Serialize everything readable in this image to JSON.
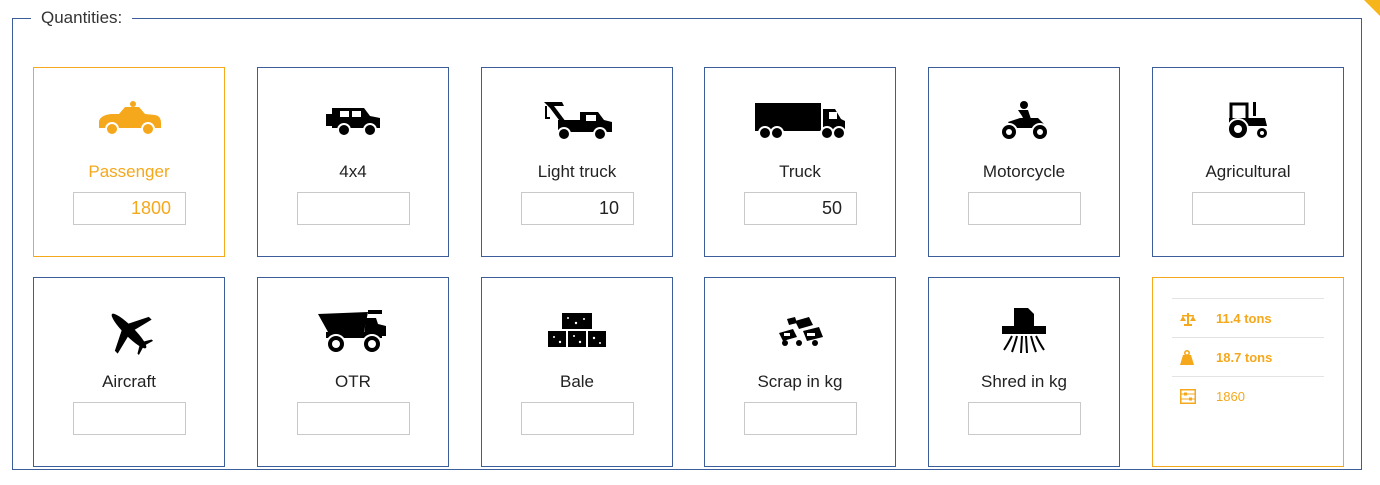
{
  "legend": "Quantities:",
  "cards": [
    {
      "id": "passenger",
      "label": "Passenger",
      "value": "1800",
      "icon": "passenger-car-icon",
      "selected": true
    },
    {
      "id": "4x4",
      "label": "4x4",
      "value": "",
      "icon": "jeep-icon",
      "selected": false
    },
    {
      "id": "light-truck",
      "label": "Light truck",
      "value": "10",
      "icon": "tow-truck-icon",
      "selected": false
    },
    {
      "id": "truck",
      "label": "Truck",
      "value": "50",
      "icon": "semi-truck-icon",
      "selected": false
    },
    {
      "id": "motorcycle",
      "label": "Motorcycle",
      "value": "",
      "icon": "motorcycle-icon",
      "selected": false
    },
    {
      "id": "agricultural",
      "label": "Agricultural",
      "value": "",
      "icon": "tractor-icon",
      "selected": false
    },
    {
      "id": "aircraft",
      "label": "Aircraft",
      "value": "",
      "icon": "airplane-icon",
      "selected": false
    },
    {
      "id": "otr",
      "label": "OTR",
      "value": "",
      "icon": "dump-truck-icon",
      "selected": false
    },
    {
      "id": "bale",
      "label": "Bale",
      "value": "",
      "icon": "bale-icon",
      "selected": false
    },
    {
      "id": "scrap",
      "label": "Scrap in kg",
      "value": "",
      "icon": "scrap-pile-icon",
      "selected": false
    },
    {
      "id": "shred",
      "label": "Shred in kg",
      "value": "",
      "icon": "shredder-icon",
      "selected": false
    }
  ],
  "summary": [
    {
      "icon": "scale-icon",
      "text": "11.4 tons",
      "bold": true
    },
    {
      "icon": "weight-icon",
      "text": "18.7 tons",
      "bold": true
    },
    {
      "icon": "abacus-icon",
      "text": "1860",
      "bold": false
    }
  ],
  "colors": {
    "accent": "#f5a81c",
    "border": "#3b5e9a",
    "text": "#222222"
  }
}
